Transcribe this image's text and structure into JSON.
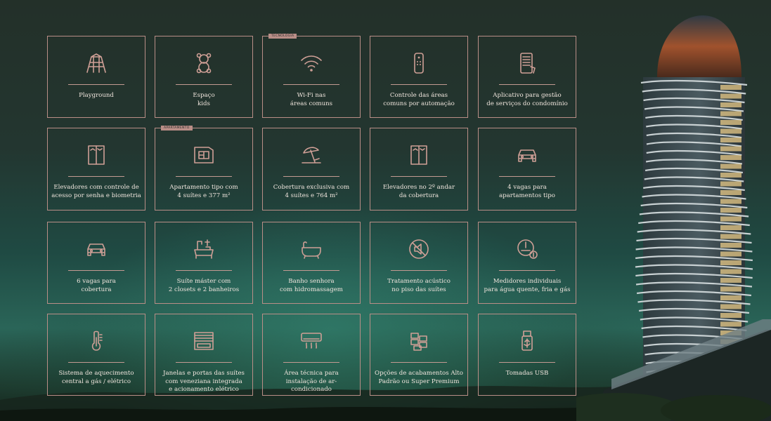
{
  "tags": {
    "tecnologia": "TECNOLOGIA",
    "apartamento": "APARTAMENTO"
  },
  "accent_color": "#b98e87",
  "cards": [
    {
      "label": "Playground",
      "icon": "playground-icon"
    },
    {
      "label": "Espaço\nkids",
      "icon": "teddy-bear-icon"
    },
    {
      "label": "Wi-Fi nas\náreas comuns",
      "icon": "wifi-icon"
    },
    {
      "label": "Controle das áreas\ncomuns por automação",
      "icon": "remote-control-icon"
    },
    {
      "label": "Aplicativo para gestão\nde serviços do condomínio",
      "icon": "smartphone-app-icon"
    },
    {
      "label": "Elevadores com controle de\nacesso por senha e biometria",
      "icon": "elevator-icon"
    },
    {
      "label": "Apartamento tipo com\n4 suítes e 377 m²",
      "icon": "floor-plan-icon"
    },
    {
      "label": "Cobertura exclusiva com\n4 suítes e 764 m²",
      "icon": "beach-umbrella-icon"
    },
    {
      "label": "Elevadores no 2º andar\nda cobertura",
      "icon": "elevator-icon"
    },
    {
      "label": "4 vagas para\napartamentos tipo",
      "icon": "car-icon"
    },
    {
      "label": "6 vagas para\ncobertura",
      "icon": "car-icon"
    },
    {
      "label": "Suíte máster com\n2 closets e 2 banheiros",
      "icon": "bathroom-icon"
    },
    {
      "label": "Banho senhora\ncom hidromassagem",
      "icon": "bathtub-icon"
    },
    {
      "label": "Tratamento acústico\nno piso das suítes",
      "icon": "no-sound-icon"
    },
    {
      "label": "Medidores individuais\npara água quente, fria e gás",
      "icon": "meter-icon"
    },
    {
      "label": "Sistema de aquecimento\ncentral a gás / elétrico",
      "icon": "thermometer-icon"
    },
    {
      "label": "Janelas e portas das suítes\ncom veneziana integrada\ne acionamento elétrico",
      "icon": "shutter-window-icon"
    },
    {
      "label": "Área técnica para\ninstalação de ar-condicionado",
      "icon": "air-conditioner-icon"
    },
    {
      "label": "Opções de acabamentos Alto\nPadrão ou Super Premium",
      "icon": "tiles-icon"
    },
    {
      "label": "Tomadas USB",
      "icon": "usb-icon"
    }
  ]
}
